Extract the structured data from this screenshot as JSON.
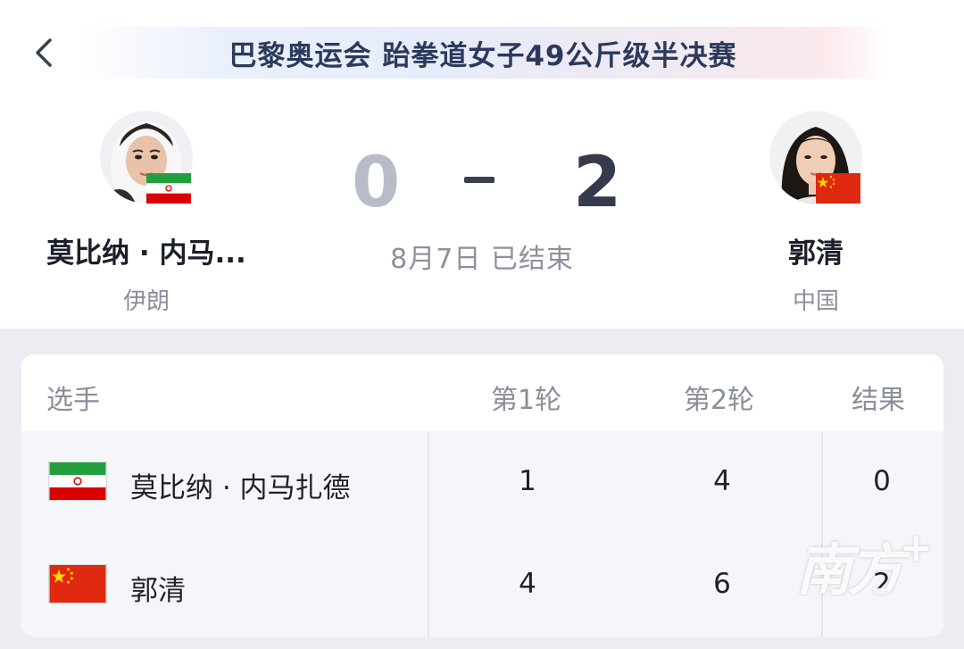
{
  "header": {
    "title": "巴黎奥运会 跆拳道女子49公斤级半决赛"
  },
  "match": {
    "left_player": {
      "name": "莫比纳 · 内马...",
      "country": "伊朗",
      "flag_icon": "iran-flag-icon"
    },
    "right_player": {
      "name": "郭清",
      "country": "中国",
      "flag_icon": "china-flag-icon"
    },
    "score_left": "0",
    "score_right": "2",
    "status": "8月7日 已结束"
  },
  "table": {
    "headers": {
      "player": "选手",
      "round1": "第1轮",
      "round2": "第2轮",
      "result": "结果"
    },
    "rows": [
      {
        "name": "莫比纳 · 内马扎德",
        "round1": "1",
        "round2": "4",
        "result": "0",
        "flag_icon": "iran-flag-icon"
      },
      {
        "name": "郭清",
        "round1": "4",
        "round2": "6",
        "result": "2",
        "flag_icon": "china-flag-icon"
      }
    ]
  },
  "watermark": {
    "text": "南方",
    "plus": "+"
  },
  "colors": {
    "score_winner": "#353b4c",
    "score_loser": "#b8bcc7",
    "title_text": "#2b3a5c",
    "iran_green": "#239f40",
    "iran_red": "#da0000",
    "china_red": "#de2910",
    "china_star": "#ffde00"
  }
}
